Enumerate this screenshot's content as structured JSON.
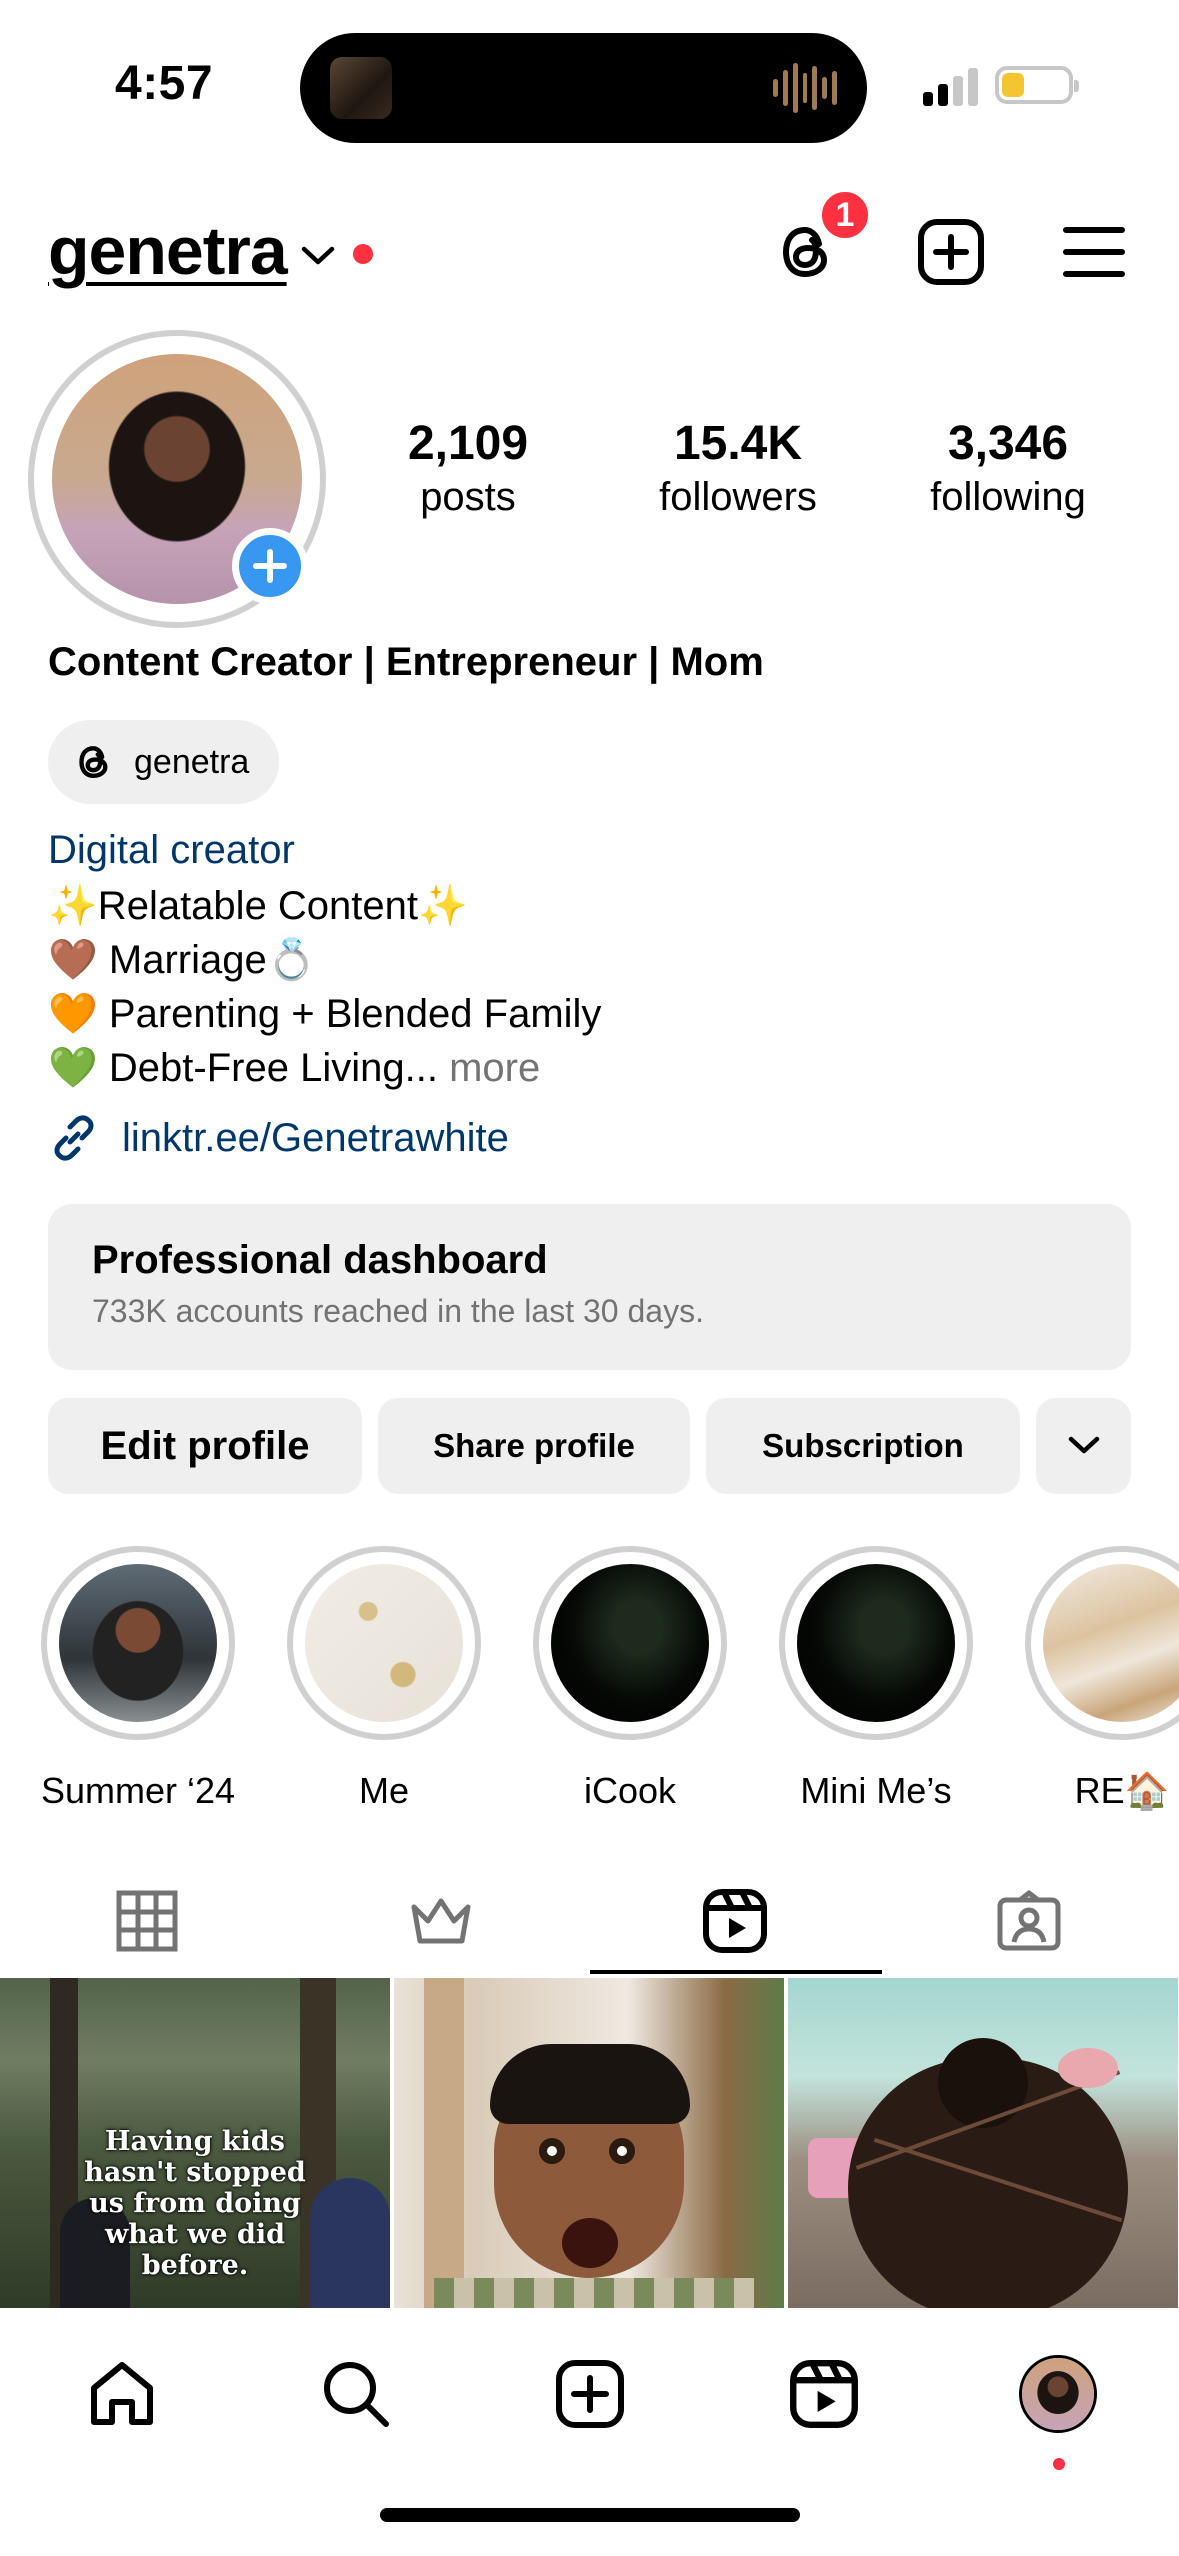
{
  "status_bar": {
    "time": "4:57",
    "colors": {
      "battery_level": "#f5c531",
      "signal_active": "#000000",
      "signal_inactive": "#c7c7c7"
    }
  },
  "header": {
    "username": "genetra",
    "threads_badge_count": "1",
    "icons": [
      "threads-icon",
      "create-icon",
      "menu-icon"
    ]
  },
  "profile": {
    "stats": [
      {
        "value": "2,109",
        "label": "posts"
      },
      {
        "value": "15.4K",
        "label": "followers"
      },
      {
        "value": "3,346",
        "label": "following"
      }
    ],
    "name": "Content Creator | Entrepreneur | Mom",
    "threads_handle": "genetra",
    "category": "Digital creator",
    "bio_lines": [
      "✨Relatable Content✨",
      "🤎 Marriage💍",
      "🧡 Parenting + Blended Family",
      "💚 Debt-Free Living..."
    ],
    "bio_more": " more",
    "link": "linktr.ee/Genetrawhite"
  },
  "dashboard": {
    "title": "Professional dashboard",
    "subtitle": "733K accounts reached in the last 30 days."
  },
  "actions": {
    "edit_profile": "Edit profile",
    "share_profile": "Share profile",
    "subscription": "Subscription"
  },
  "highlights": [
    {
      "label": "Summer ‘24"
    },
    {
      "label": "Me"
    },
    {
      "label": "iCook"
    },
    {
      "label": "Mini Me’s"
    },
    {
      "label": "RE🏠"
    }
  ],
  "tabs": [
    "grid",
    "subscriptions",
    "reels",
    "tagged"
  ],
  "active_tab": "reels",
  "grid_posts": [
    {
      "caption": "Having kids hasn't stopped us from doing what we did before."
    },
    {
      "caption": ""
    },
    {
      "caption": ""
    }
  ],
  "bottom_nav": [
    "home",
    "search",
    "create",
    "reels",
    "profile"
  ],
  "colors": {
    "accent_blue": "#3897f0",
    "link_blue": "#00376b",
    "notification_red": "#ff3040",
    "button_bg": "#efefef",
    "muted_text": "#737373"
  }
}
